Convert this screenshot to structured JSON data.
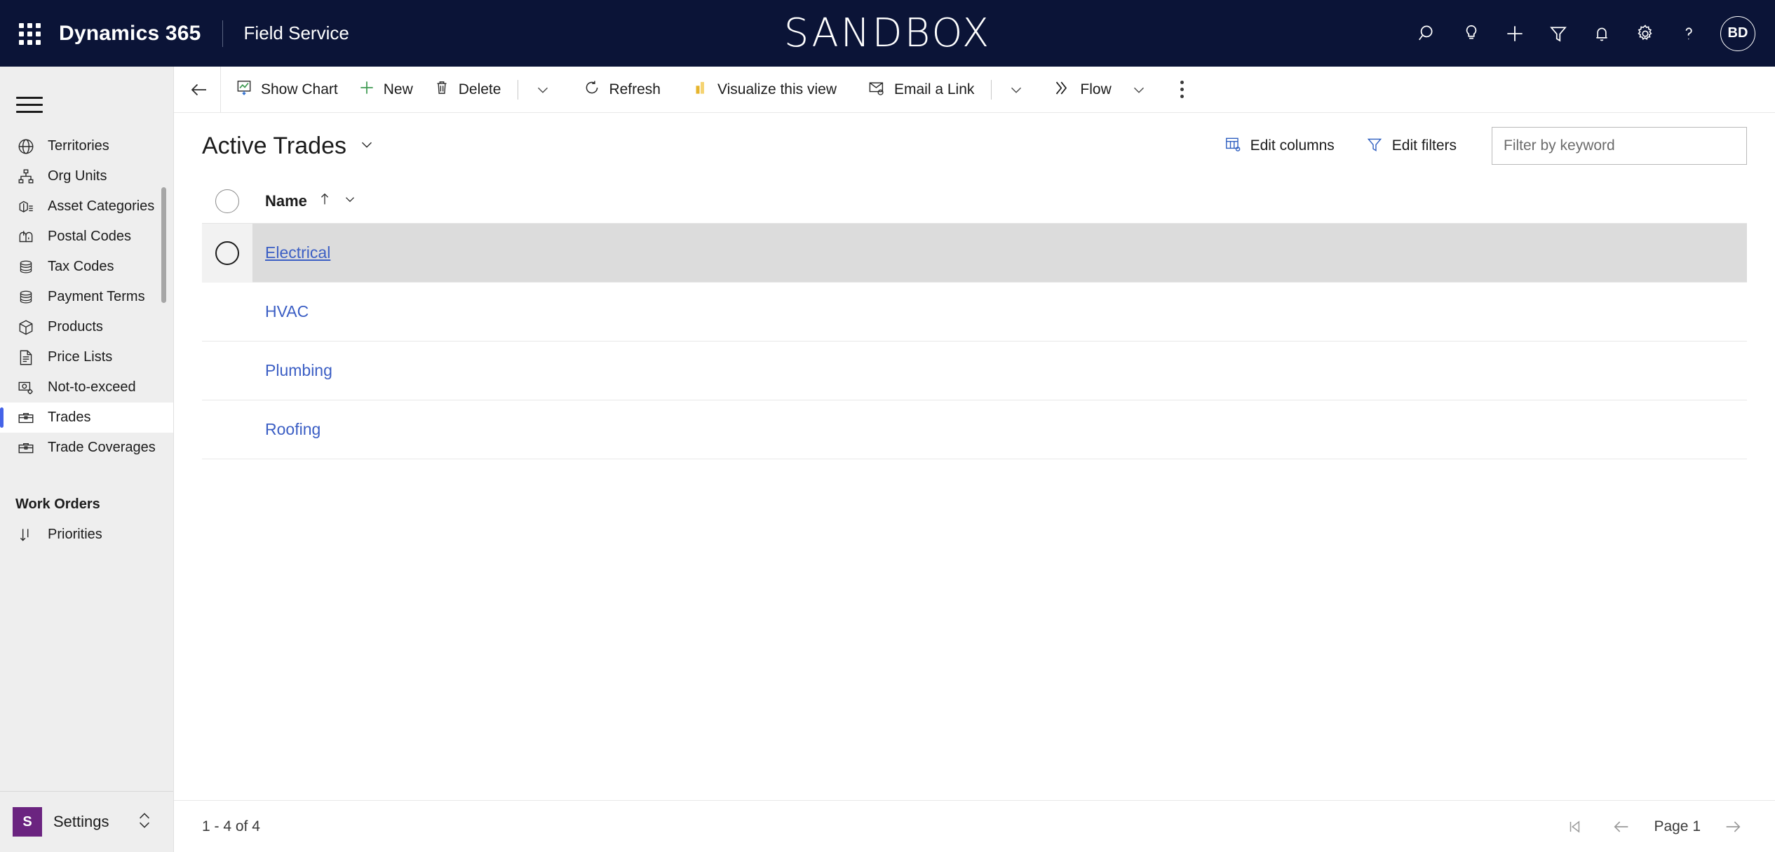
{
  "header": {
    "waffle_icon": "app-launcher-icon",
    "brand": "Dynamics 365",
    "app_name": "Field Service",
    "environment_banner": "SANDBOX",
    "actions": [
      {
        "name": "search-icon",
        "label": "Search"
      },
      {
        "name": "lightbulb-icon",
        "label": "Insights"
      },
      {
        "name": "plus-icon",
        "label": "Quick create"
      },
      {
        "name": "filter-icon",
        "label": "Filter"
      },
      {
        "name": "bell-icon",
        "label": "Notifications"
      },
      {
        "name": "gear-icon",
        "label": "Settings"
      },
      {
        "name": "question-icon",
        "label": "Help"
      }
    ],
    "avatar_initials": "BD"
  },
  "sidebar": {
    "hamburger_icon": "hamburger-menu-icon",
    "items": [
      {
        "label": "Territories",
        "icon": "globe-icon",
        "selected": false
      },
      {
        "label": "Org Units",
        "icon": "org-chart-icon",
        "selected": false
      },
      {
        "label": "Asset Categories",
        "icon": "asset-box-icon",
        "selected": false
      },
      {
        "label": "Postal Codes",
        "icon": "mailbox-icon",
        "selected": false
      },
      {
        "label": "Tax Codes",
        "icon": "coins-icon",
        "selected": false
      },
      {
        "label": "Payment Terms",
        "icon": "coins-icon",
        "selected": false
      },
      {
        "label": "Products",
        "icon": "product-box-icon",
        "selected": false
      },
      {
        "label": "Price Lists",
        "icon": "document-list-icon",
        "selected": false
      },
      {
        "label": "Not-to-exceed",
        "icon": "money-gear-icon",
        "selected": false
      },
      {
        "label": "Trades",
        "icon": "toolbox-icon",
        "selected": true
      },
      {
        "label": "Trade Coverages",
        "icon": "toolbox-icon",
        "selected": false
      }
    ],
    "group_title": "Work Orders",
    "group_items": [
      {
        "label": "Priorities",
        "icon": "sort-down-icon",
        "selected": false
      }
    ],
    "footer": {
      "badge": "S",
      "label": "Settings",
      "switcher_icon": "chevron-up-down-icon",
      "badge_color": "#6b2480"
    }
  },
  "command_bar": {
    "back_icon": "back-arrow-icon",
    "buttons": [
      {
        "label": "Show Chart",
        "icon": "chart-icon"
      },
      {
        "label": "New",
        "icon": "plus-icon"
      },
      {
        "label": "Delete",
        "icon": "trash-icon"
      }
    ],
    "overflow_chevron_1": "chevron-down-icon",
    "buttons2": [
      {
        "label": "Refresh",
        "icon": "refresh-icon"
      },
      {
        "label": "Visualize this view",
        "icon": "powerbi-bars-icon"
      },
      {
        "label": "Email a Link",
        "icon": "email-link-icon"
      }
    ],
    "overflow_chevron_2": "chevron-down-icon",
    "flow": {
      "label": "Flow",
      "icon": "flow-icon",
      "chevron": "chevron-down-icon"
    },
    "more_icon": "more-vertical-icon"
  },
  "view": {
    "title": "Active Trades",
    "title_chevron": "chevron-down-icon",
    "edit_columns": {
      "label": "Edit columns",
      "icon": "edit-columns-icon"
    },
    "edit_filters": {
      "label": "Edit filters",
      "icon": "edit-filters-icon"
    },
    "search": {
      "placeholder": "Filter by keyword",
      "value": ""
    }
  },
  "grid": {
    "select_all_icon": "select-all-circle-icon",
    "columns": [
      {
        "label": "Name",
        "sort": "ascending",
        "sort_icon": "arrow-up-icon",
        "menu_icon": "chevron-down-icon"
      }
    ],
    "rows": [
      {
        "name": "Electrical",
        "hovered": true
      },
      {
        "name": "HVAC",
        "hovered": false
      },
      {
        "name": "Plumbing",
        "hovered": false
      },
      {
        "name": "Roofing",
        "hovered": false
      }
    ]
  },
  "footer": {
    "record_count": "1 - 4 of 4",
    "first_page_icon": "first-page-icon",
    "prev_page_icon": "previous-page-icon",
    "page_label": "Page 1",
    "next_page_icon": "next-page-icon"
  },
  "colors": {
    "header_bg": "#0b1437",
    "sidebar_bg": "#eeeeee",
    "accent": "#4563e8",
    "link": "#3b5ec4",
    "row_hover": "#dcdcdc",
    "settings_badge": "#6b2480"
  }
}
